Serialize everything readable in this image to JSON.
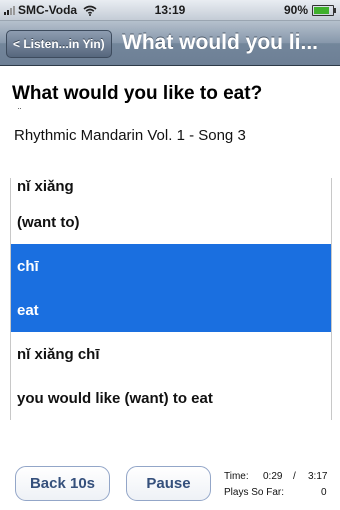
{
  "status_bar": {
    "carrier": "SMC-Voda",
    "time": "13:19",
    "battery": "90%",
    "battery_level": 0.9,
    "signal_icon": "signal-bars-icon",
    "wifi_icon": "wifi-icon"
  },
  "nav": {
    "back_label": "< Listen...in Yin)",
    "title": "What would you li..."
  },
  "song": {
    "title": "What would you like to eat?",
    "tick": "¨",
    "subtitle": "Rhythmic Mandarin Vol. 1 - Song 3"
  },
  "lyrics": [
    {
      "text": "nǐ xiǎng",
      "highlighted": false
    },
    {
      "text": "(want to)",
      "highlighted": false
    },
    {
      "text": "chī",
      "highlighted": true
    },
    {
      "text": "eat",
      "highlighted": true
    },
    {
      "text": "nǐ xiǎng chī",
      "highlighted": false
    },
    {
      "text": "you would like (want) to eat",
      "highlighted": false
    }
  ],
  "controls": {
    "back_label": "Back 10s",
    "pause_label": "Pause",
    "time_label": "Time:",
    "time_current": "0:29",
    "time_sep": "/",
    "time_total": "3:17",
    "plays_label": "Plays So Far:",
    "plays_value": "0"
  },
  "colors": {
    "highlight": "#1a6fe0",
    "button_text": "#35507c",
    "battery_green": "#3fb02c"
  }
}
